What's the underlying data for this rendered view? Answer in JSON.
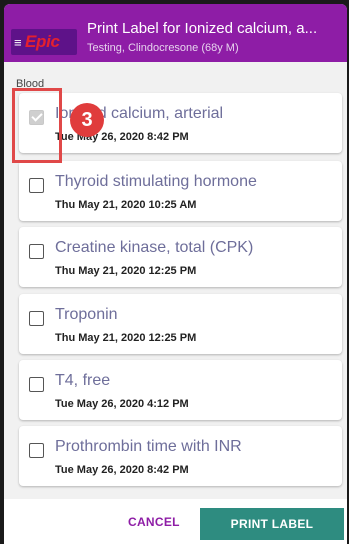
{
  "header": {
    "menu_icon": "≡",
    "logo_text": "Epic",
    "title": "Print Label for Ionized calcium, a...",
    "subtitle": "Testing, Clindocresone (68y M)"
  },
  "section_label": "Blood",
  "items": [
    {
      "name": "Ionized calcium, arterial",
      "date": "Tue May 26, 2020  8:42 PM",
      "checked": true
    },
    {
      "name": "Thyroid stimulating hormone",
      "date": "Thu May 21, 2020 10:25 AM",
      "checked": false
    },
    {
      "name": "Creatine kinase, total (CPK)",
      "date": "Thu May 21, 2020 12:25 PM",
      "checked": false
    },
    {
      "name": "Troponin",
      "date": "Thu May 21, 2020 12:25 PM",
      "checked": false
    },
    {
      "name": "T4, free",
      "date": "Tue May 26, 2020  4:12 PM",
      "checked": false
    },
    {
      "name": "Prothrombin time with INR",
      "date": "Tue May 26, 2020  8:42 PM",
      "checked": false
    }
  ],
  "annotation": {
    "step_number": "3"
  },
  "footer": {
    "cancel_label": "CANCEL",
    "print_label": "PRINT LABEL"
  },
  "colors": {
    "header": "#8e1da6",
    "primary_button": "#2e8c80",
    "highlight": "#e04848"
  }
}
